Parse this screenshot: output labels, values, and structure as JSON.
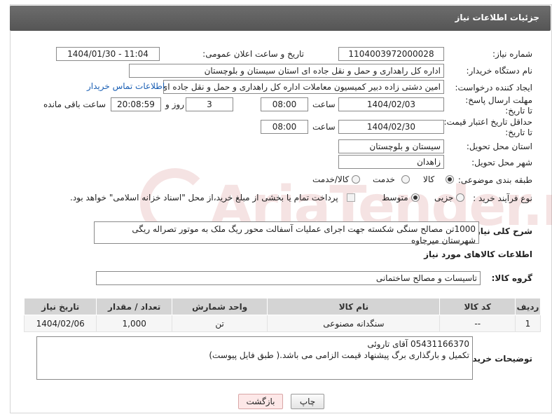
{
  "header": {
    "title": "جزئیات اطلاعات نیاز"
  },
  "fields": {
    "need_number_label": "شماره نیاز:",
    "need_number": "1104003972000028",
    "announce_label": "تاریخ و ساعت اعلان عمومی:",
    "announce_value": "1404/01/30 - 11:04",
    "buyer_org_label": "نام دستگاه خریدار:",
    "buyer_org": "اداره کل راهداری و حمل و نقل جاده ای استان سیستان و بلوچستان",
    "requester_label": "ایجاد کننده درخواست:",
    "requester": "امین دشتی زاده دبیر کمیسیون معاملات اداره کل راهداری و حمل و نقل جاده ای",
    "contact_link": "اطلاعات تماس خریدار",
    "deadline_label": "مهلت ارسال پاسخ: تا تاریخ:",
    "deadline_date": "1404/02/03",
    "time_label": "ساعت",
    "deadline_time": "08:00",
    "days_value": "3",
    "days_label": "روز و",
    "remaining_time": "20:08:59",
    "remaining_label": "ساعت باقی مانده",
    "min_validity_label": "حداقل تاریخ اعتبار قیمت: تا تاریخ:",
    "validity_date": "1404/02/30",
    "validity_time": "08:00",
    "province_label": "استان محل تحویل:",
    "province": "سیستان و بلوچستان",
    "city_label": "شهر محل تحویل:",
    "city": "زاهدان",
    "category_label": "طبقه بندی موضوعی:",
    "category_options": [
      "کالا",
      "خدمت",
      "کالا/خدمت"
    ],
    "category_selected": "کالا",
    "process_label": "نوع فرآیند خرید :",
    "process_options": [
      "جزیی",
      "متوسط"
    ],
    "process_selected": "متوسط",
    "payment_note": "پرداخت تمام یا بخشی از مبلغ خرید،از محل \"اسناد خزانه اسلامی\" خواهد بود."
  },
  "description": {
    "label": "شرح کلی نیاز:",
    "text": "1000تن مصالح سنگی شکسته جهت اجرای عملیات آسفالت محور ریگ ملک به موتور تصراله ریگی شهرستان میرجاوه"
  },
  "goods": {
    "section_title": "اطلاعات کالاهای مورد نیاز",
    "group_label": "گروه کالا:",
    "group_value": "تاسیسات و مصالح ساختمانی",
    "columns": [
      "ردیف",
      "کد کالا",
      "نام کالا",
      "واحد شمارش",
      "تعداد / مقدار",
      "تاریخ نیاز"
    ],
    "rows": [
      [
        "1",
        "--",
        "سنگدانه مصنوعی",
        "تن",
        "1,000",
        "1404/02/06"
      ]
    ]
  },
  "buyer_notes": {
    "label": "توضیحات خریدار:",
    "line1": "05431166370 آقای تاروئی",
    "line2": "تکمیل و بارگذاری برگ پیشنهاد قیمت الزامی می باشد.( طبق فایل پیوست)"
  },
  "buttons": {
    "print": "چاپ",
    "back": "بازگشت"
  },
  "watermark": {
    "text": "AriaTender.neT"
  }
}
